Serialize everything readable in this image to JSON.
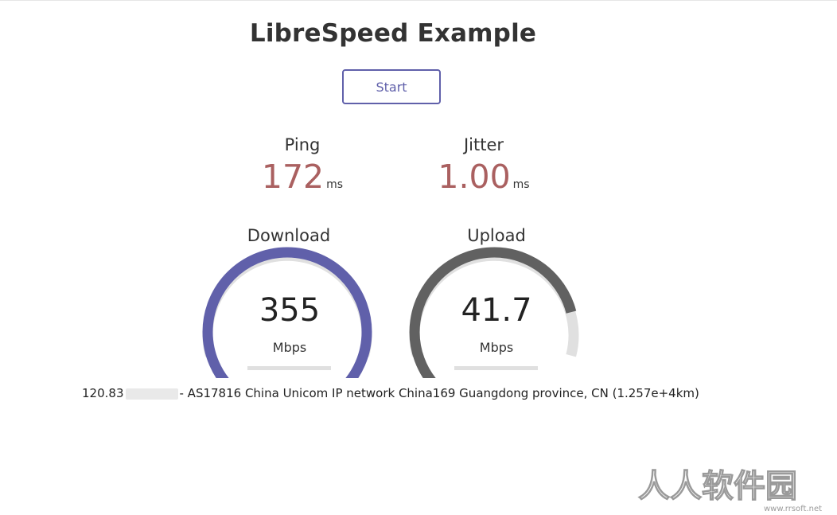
{
  "app": {
    "title": "LibreSpeed Example"
  },
  "controls": {
    "start_label": "Start"
  },
  "ping": {
    "label": "Ping",
    "value": "172",
    "unit": "ms"
  },
  "jitter": {
    "label": "Jitter",
    "value": "1.00",
    "unit": "ms"
  },
  "download": {
    "label": "Download",
    "value": "355",
    "unit": "Mbps",
    "gauge_fraction": 1.0,
    "progress_fraction": 1.0,
    "color": "#6060AA"
  },
  "upload": {
    "label": "Upload",
    "value": "41.7",
    "unit": "Mbps",
    "gauge_fraction": 0.78,
    "progress_fraction": 1.0,
    "color": "#616161"
  },
  "ip_info": {
    "ip_prefix": "120.83",
    "isp_text": "- AS17816 China Unicom IP network China169 Guangdong province, CN (1.257e+4km)"
  },
  "watermark": {
    "text": "人人软件园",
    "sub_text": "www.rrsoft.net"
  },
  "colors": {
    "accent": "#6060AA",
    "metric_value": "#AA6060",
    "gauge_track": "#E0E0E0"
  }
}
